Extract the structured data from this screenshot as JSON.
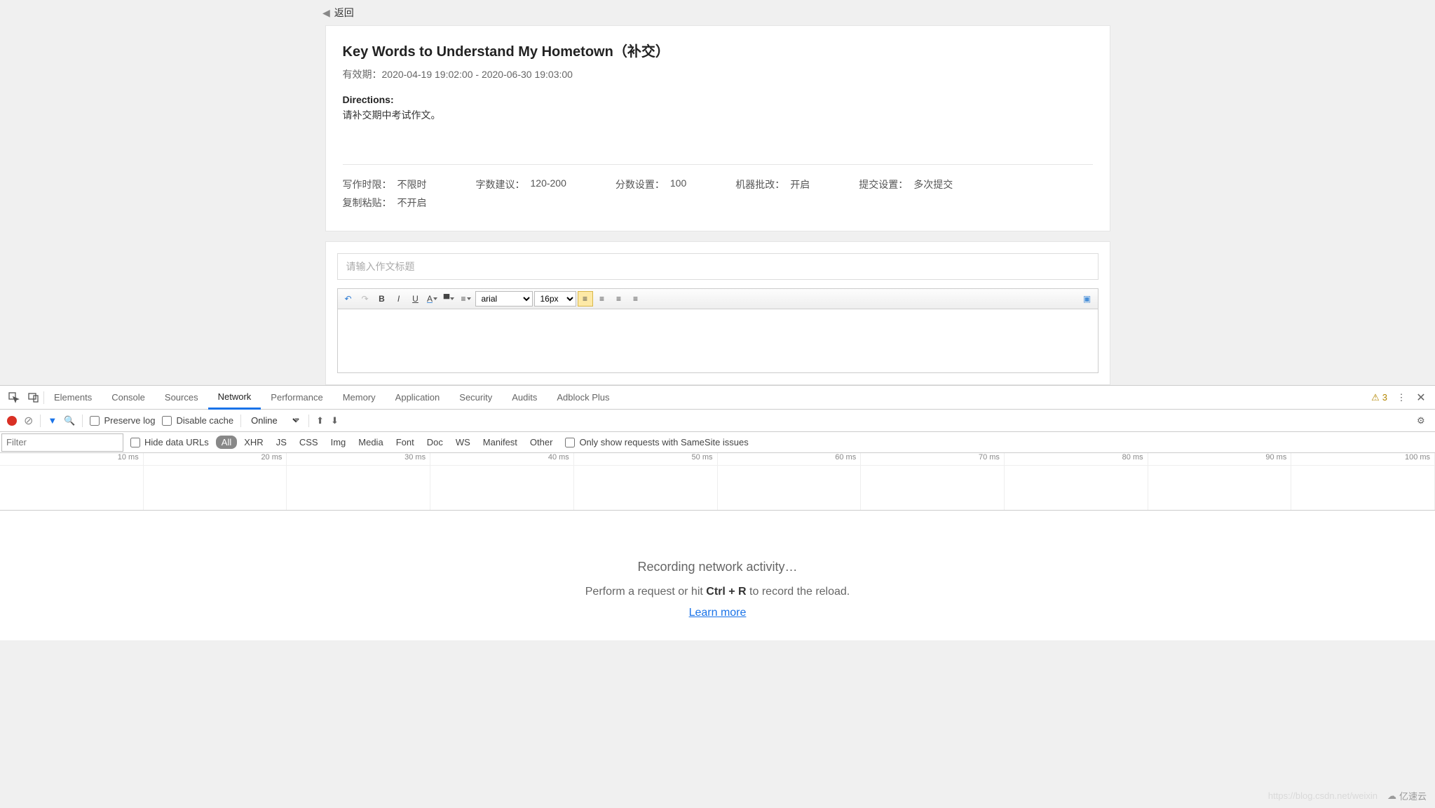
{
  "back_label": "返回",
  "assignment": {
    "title": "Key Words to Understand My Hometown（补交）",
    "validity_label": "有效期：",
    "validity_value": "2020-04-19 19:02:00 - 2020-06-30 19:03:00",
    "directions_label": "Directions:",
    "directions_text": "请补交期中考试作文。",
    "meta": {
      "time_limit_label": "写作时限：",
      "time_limit_value": "不限时",
      "word_count_label": "字数建议：",
      "word_count_value": "120-200",
      "score_label": "分数设置：",
      "score_value": "100",
      "auto_grade_label": "机器批改：",
      "auto_grade_value": "开启",
      "submit_label": "提交设置：",
      "submit_value": "多次提交",
      "copy_label": "复制粘贴：",
      "copy_value": "不开启"
    }
  },
  "editor": {
    "title_placeholder": "请输入作文标题",
    "font_family": "arial",
    "font_size": "16px"
  },
  "devtools": {
    "tabs": [
      "Elements",
      "Console",
      "Sources",
      "Network",
      "Performance",
      "Memory",
      "Application",
      "Security",
      "Audits",
      "Adblock Plus"
    ],
    "active_tab": "Network",
    "warning_count": "3",
    "preserve_log": "Preserve log",
    "disable_cache": "Disable cache",
    "throttling": "Online",
    "filter_placeholder": "Filter",
    "hide_data_urls": "Hide data URLs",
    "type_filters": [
      "All",
      "XHR",
      "JS",
      "CSS",
      "Img",
      "Media",
      "Font",
      "Doc",
      "WS",
      "Manifest",
      "Other"
    ],
    "samesite": "Only show requests with SameSite issues",
    "timeline_ticks": [
      "10 ms",
      "20 ms",
      "30 ms",
      "40 ms",
      "50 ms",
      "60 ms",
      "70 ms",
      "80 ms",
      "90 ms",
      "100 ms"
    ],
    "empty_title": "Recording network activity…",
    "empty_sub_pre": "Perform a request or hit ",
    "empty_sub_kbd": "Ctrl + R",
    "empty_sub_post": " to record the reload.",
    "learn_more": "Learn more"
  },
  "watermark": {
    "url": "https://blog.csdn.net/weixin",
    "brand": "亿速云"
  }
}
